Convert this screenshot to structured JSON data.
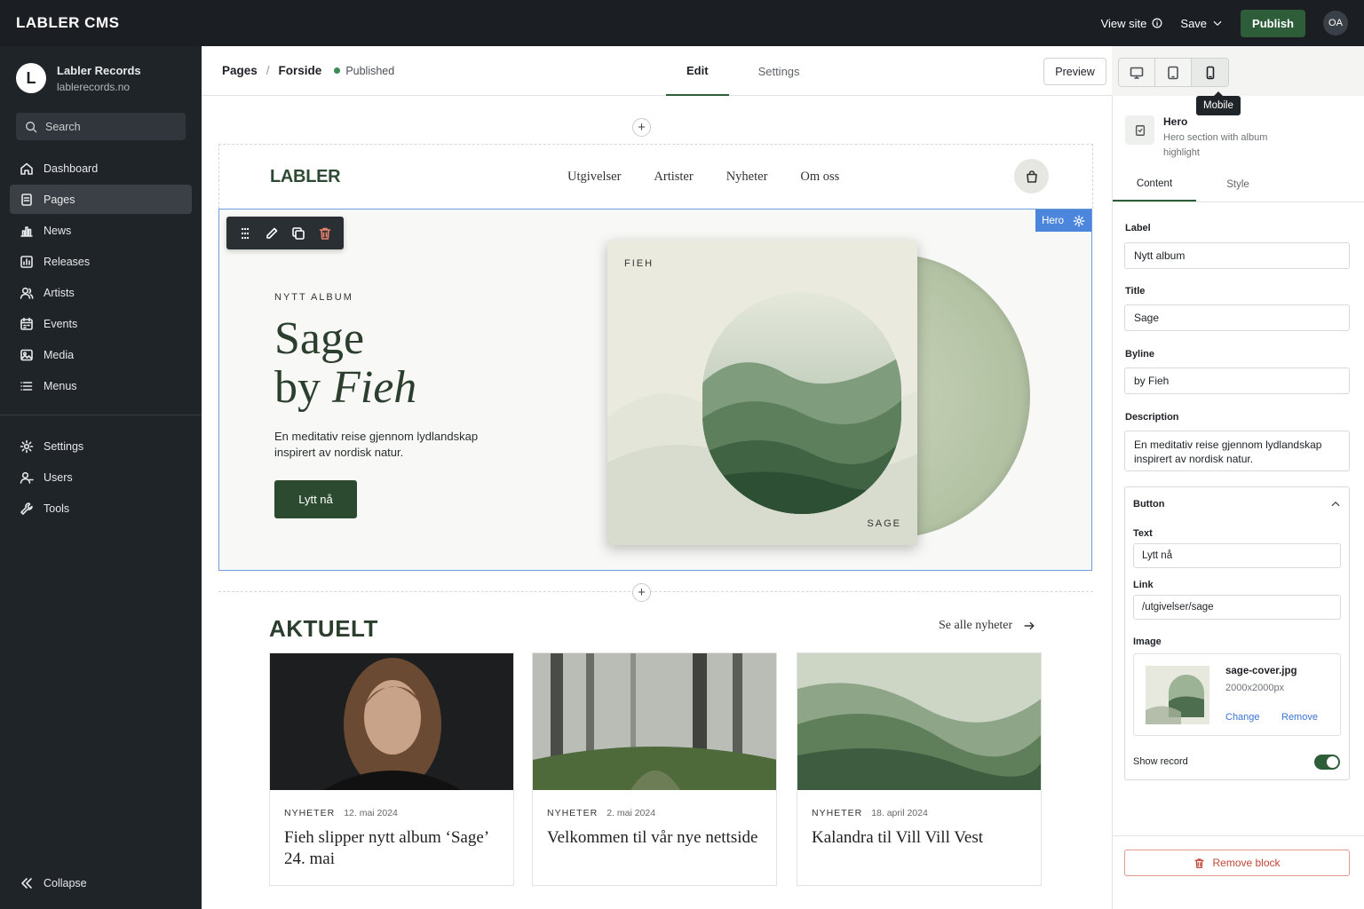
{
  "topbar": {
    "brand": "LABLER CMS",
    "view_site": "View site",
    "save": "Save",
    "publish": "Publish",
    "avatar": "OA"
  },
  "sidebar": {
    "site_initial": "L",
    "site_name": "Labler Records",
    "site_domain": "lablerecords.no",
    "search_placeholder": "Search",
    "items": [
      {
        "label": "Dashboard",
        "icon": "home-icon"
      },
      {
        "label": "Pages",
        "icon": "pages-icon",
        "active": true
      },
      {
        "label": "News",
        "icon": "news-icon"
      },
      {
        "label": "Releases",
        "icon": "releases-icon"
      },
      {
        "label": "Artists",
        "icon": "artists-icon"
      },
      {
        "label": "Events",
        "icon": "calendar-icon"
      },
      {
        "label": "Media",
        "icon": "image-icon"
      },
      {
        "label": "Menus",
        "icon": "menu-icon"
      }
    ],
    "secondary": [
      {
        "label": "Settings",
        "icon": "gear-icon"
      },
      {
        "label": "Users",
        "icon": "users-icon"
      },
      {
        "label": "Tools",
        "icon": "wrench-icon"
      }
    ],
    "collapse": "Collapse"
  },
  "editor": {
    "breadcrumb_root": "Pages",
    "breadcrumb_page": "Forside",
    "status": "Published",
    "tabs": [
      "Edit",
      "Settings"
    ],
    "preview": "Preview",
    "tooltip": "Mobile"
  },
  "site": {
    "brand": "LABLER",
    "nav": [
      "Utgivelser",
      "Artister",
      "Nyheter",
      "Om oss"
    ],
    "hero": {
      "tag": "Hero",
      "label": "NYTT ALBUM",
      "title_line1": "Sage",
      "title_by": "by ",
      "title_artist": "Fieh",
      "description": "En meditativ reise gjennom lydlandskap inspirert av nordisk natur.",
      "button": "Lytt nå",
      "art_artist": "FIEH",
      "art_title": "SAGE"
    },
    "news": {
      "title": "AKTUELT",
      "see_all": "Se alle nyheter",
      "cards": [
        {
          "category": "NYHETER",
          "date": "12. mai 2024",
          "title": "Fieh slipper nytt album ‘Sage’ 24. mai"
        },
        {
          "category": "NYHETER",
          "date": "2. mai 2024",
          "title": "Velkommen til vår nye nettside"
        },
        {
          "category": "NYHETER",
          "date": "18. april 2024",
          "title": "Kalandra til Vill Vill Vest"
        }
      ]
    }
  },
  "panel": {
    "block_title": "Hero",
    "block_subtitle": "Hero section with album highlight",
    "tabs": [
      "Content",
      "Style"
    ],
    "fields": {
      "label_label": "Label",
      "label_value": "Nytt album",
      "title_label": "Title",
      "title_value": "Sage",
      "byline_label": "Byline",
      "byline_value": "by Fieh",
      "description_label": "Description",
      "description_value": "En meditativ reise gjennom lydlandskap inspirert av nordisk natur."
    },
    "button_group": {
      "heading": "Button",
      "text_label": "Text",
      "text_value": "Lytt nå",
      "link_label": "Link",
      "link_value": "/utgivelser/sage",
      "image_label": "Image",
      "image_name": "sage-cover.jpg",
      "image_dims": "2000x2000px",
      "change": "Change",
      "remove": "Remove",
      "show_record": "Show record",
      "show_record_on": true
    },
    "remove_block": "Remove block"
  },
  "colors": {
    "accent": "#2e5d3a",
    "selection": "#4c86dc",
    "danger": "#c2473a"
  }
}
